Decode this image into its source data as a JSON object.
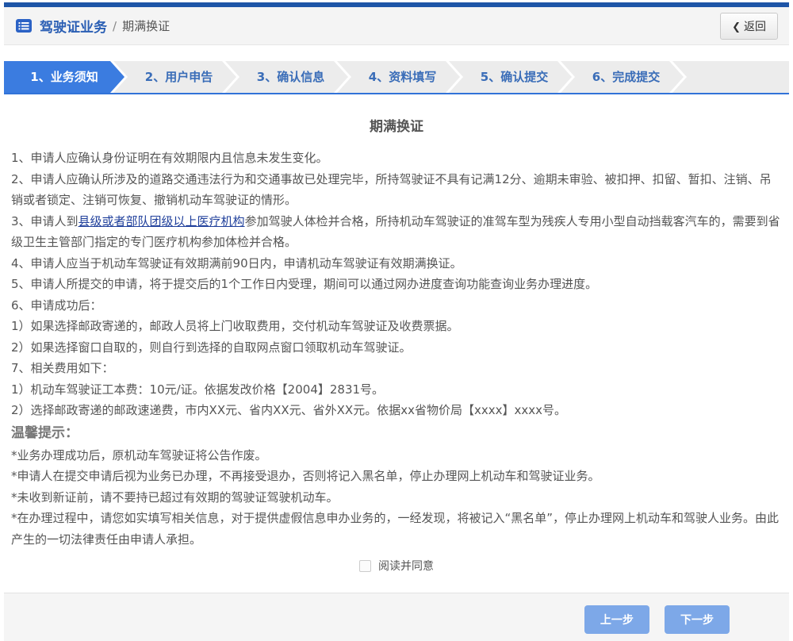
{
  "header": {
    "breadcrumb_section": "驾驶证业务",
    "breadcrumb_divider": "/",
    "breadcrumb_page": "期满换证",
    "back_arrow": "❮",
    "back_label": "返回"
  },
  "steps": {
    "items": [
      {
        "label": "1、业务须知",
        "state": "active"
      },
      {
        "label": "2、用户申告",
        "state": "pending"
      },
      {
        "label": "3、确认信息",
        "state": "pending"
      },
      {
        "label": "4、资料填写",
        "state": "pending"
      },
      {
        "label": "5、确认提交",
        "state": "pending"
      },
      {
        "label": "6、完成提交",
        "state": "pending"
      }
    ]
  },
  "content": {
    "title": "期满换证",
    "paragraphs": [
      "1、申请人应确认身份证明在有效期限内且信息未发生变化。",
      "2、申请人应确认所涉及的道路交通违法行为和交通事故已处理完毕，所持驾驶证不具有记满12分、逾期未审验、被扣押、扣留、暂扣、注销、吊销或者锁定、注销可恢复、撤销机动车驾驶证的情形。",
      "4、申请人应当于机动车驾驶证有效期满前90日内，申请机动车驾驶证有效期满换证。",
      "5、申请人所提交的申请，将于提交后的1个工作日内受理，期间可以通过网办进度查询功能查询业务办理进度。",
      "6、申请成功后：",
      "1）如果选择邮政寄递的，邮政人员将上门收取费用，交付机动车驾驶证及收费票据。",
      "2）如果选择窗口自取的，则自行到选择的自取网点窗口领取机动车驾驶证。",
      "7、相关费用如下：",
      "1）机动车驾驶证工本费：10元/证。依据发改价格【2004】2831号。",
      "2）选择邮政寄递的邮政速递费，市内XX元、省内XX元、省外XX元。依据xx省物价局【xxxx】xxxx号。"
    ],
    "medical_line": {
      "pre": "3、申请人到",
      "link": "县级或者部队团级以上医疗机构",
      "post": "参加驾驶人体检并合格，所持机动车驾驶证的准驾车型为残疾人专用小型自动挡载客汽车的，需要到省级卫生主管部门指定的专门医疗机构参加体检并合格。"
    },
    "tips_title": "温馨提示：",
    "tips": [
      "*业务办理成功后，原机动车驾驶证将公告作废。",
      "*申请人在提交申请后视为业务已办理，不再接受退办，否则将记入黑名单，停止办理网上机动车和驾驶证业务。",
      "*未收到新证前，请不要持已超过有效期的驾驶证驾驶机动车。",
      "*在办理过程中，请您如实填写相关信息，对于提供虚假信息申办业务的，一经发现，将被记入“黑名单”，停止办理网上机动车和驾驶人业务。由此产生的一切法律责任由申请人承担。"
    ],
    "agree_label": "阅读并同意",
    "agree_checked": false
  },
  "footer": {
    "prev_label": "上一步",
    "next_label": "下一步"
  },
  "colors": {
    "topbar_blue": "#1e55a7",
    "active_step_blue": "#3b7ce0",
    "step_text_blue": "#3a6db8",
    "step_border_blue": "#3273d8",
    "button_blue": "#7da8e8",
    "link_blue": "#1f3f9b",
    "breadcrumb_blue": "#2b5fb4",
    "body_text": "#555555",
    "header_bg": "#f4f4f4",
    "step_bg": "#ececec",
    "footer_bg": "#f5f5f5"
  }
}
